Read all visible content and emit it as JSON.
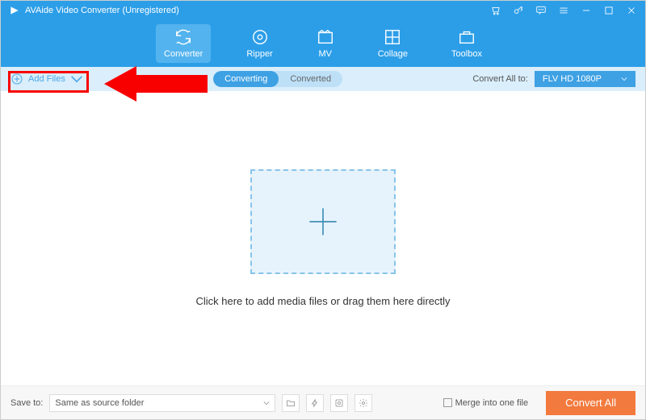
{
  "title": "AVAide Video Converter (Unregistered)",
  "nav": {
    "items": [
      {
        "label": "Converter",
        "active": true
      },
      {
        "label": "Ripper"
      },
      {
        "label": "MV"
      },
      {
        "label": "Collage"
      },
      {
        "label": "Toolbox"
      }
    ]
  },
  "toolbar": {
    "add_files_label": "Add Files",
    "tabs": {
      "converting": "Converting",
      "converted": "Converted"
    },
    "convert_all_to_label": "Convert All to:",
    "selected_format": "FLV HD 1080P"
  },
  "main": {
    "drop_text": "Click here to add media files or drag them here directly"
  },
  "footer": {
    "save_to_label": "Save to:",
    "save_to_value": "Same as source folder",
    "merge_label": "Merge into one file",
    "convert_all_btn": "Convert All"
  }
}
